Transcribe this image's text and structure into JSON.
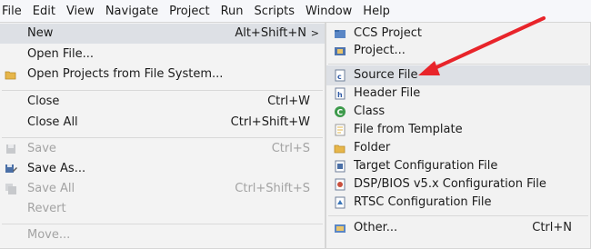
{
  "menubar": {
    "items": [
      "File",
      "Edit",
      "View",
      "Navigate",
      "Project",
      "Run",
      "Scripts",
      "Window",
      "Help"
    ]
  },
  "file_menu": {
    "new": {
      "label": "New",
      "accelerator": "Alt+Shift+N",
      "arrow": ">"
    },
    "open_file": {
      "label": "Open File..."
    },
    "open_projects": {
      "label": "Open Projects from File System..."
    },
    "close": {
      "label": "Close",
      "accelerator": "Ctrl+W"
    },
    "close_all": {
      "label": "Close All",
      "accelerator": "Ctrl+Shift+W"
    },
    "save": {
      "label": "Save",
      "accelerator": "Ctrl+S"
    },
    "save_as": {
      "label": "Save As..."
    },
    "save_all": {
      "label": "Save All",
      "accelerator": "Ctrl+Shift+S"
    },
    "revert": {
      "label": "Revert"
    },
    "move": {
      "label": "Move..."
    }
  },
  "new_submenu": {
    "ccs_project": {
      "label": "CCS Project"
    },
    "project": {
      "label": "Project..."
    },
    "source_file": {
      "label": "Source File"
    },
    "header_file": {
      "label": "Header File"
    },
    "class": {
      "label": "Class"
    },
    "file_from_template": {
      "label": "File from Template"
    },
    "folder": {
      "label": "Folder"
    },
    "target_config_file": {
      "label": "Target Configuration File"
    },
    "dsp_bios_config_file": {
      "label": "DSP/BIOS v5.x Configuration File"
    },
    "rtsc_config_file": {
      "label": "RTSC Configuration File"
    },
    "other": {
      "label": "Other...",
      "accelerator": "Ctrl+N"
    }
  },
  "colors": {
    "highlight": "#dde0e5",
    "disabled_text": "#a3a3a3",
    "arrow_annotation": "#e8242a"
  }
}
